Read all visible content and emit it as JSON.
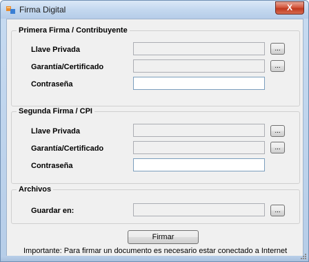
{
  "window": {
    "title": "Firma Digital",
    "close_label": "X"
  },
  "groups": {
    "first": {
      "title": "Primera Firma / Contribuyente",
      "private_key_label": "Llave Privada",
      "certificate_label": "Garantía/Certificado",
      "password_label": "Contraseña",
      "private_key_value": "",
      "certificate_value": "",
      "password_value": ""
    },
    "second": {
      "title": "Segunda Firma / CPI",
      "private_key_label": "Llave Privada",
      "certificate_label": "Garantía/Certificado",
      "password_label": "Contraseña",
      "private_key_value": "",
      "certificate_value": "",
      "password_value": ""
    },
    "files": {
      "title": "Archivos",
      "save_in_label": "Guardar en:",
      "save_in_value": ""
    }
  },
  "browse_label": "...",
  "sign_button_label": "Firmar",
  "footer_note": "Importante: Para firmar un documento es necesario estar conectado a Internet",
  "colors": {
    "frame": "#c4d8ef",
    "close_button": "#c0391f",
    "client_background": "#f0f0f0"
  },
  "icons": {
    "title_icon": "app-window-icon",
    "close_icon": "close-icon",
    "resize_icon": "resize-grip-icon"
  }
}
